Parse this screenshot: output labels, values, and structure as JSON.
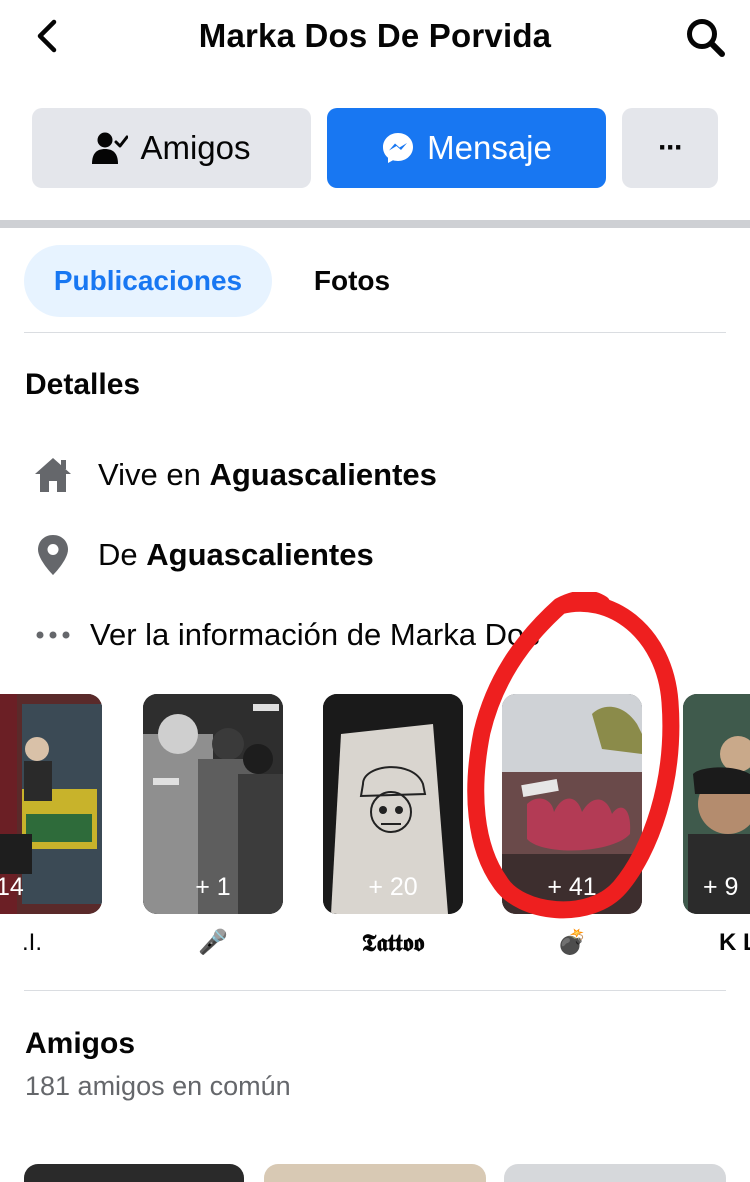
{
  "header": {
    "title": "Marka Dos De Porvida",
    "back_icon": "chevron-left-icon",
    "search_icon": "search-icon"
  },
  "actions": {
    "friends_label": "Amigos",
    "message_label": "Mensaje",
    "more_label": "···",
    "accent_color": "#1877f2"
  },
  "tabs": [
    {
      "label": "Publicaciones",
      "active": true
    },
    {
      "label": "Fotos",
      "active": false
    }
  ],
  "details": {
    "title": "Detalles",
    "lives_prefix": "Vive en ",
    "lives_city": "Aguascalientes",
    "from_prefix": "De ",
    "from_city": "Aguascalientes",
    "more_info": "Ver la información de Marka Dos"
  },
  "highlights": [
    {
      "count": "14",
      "label": ".I."
    },
    {
      "count": "+ 1",
      "label": "🎤"
    },
    {
      "count": "+ 20",
      "label": "𝕿𝖆𝖙𝖙𝖔𝖔"
    },
    {
      "count": "+ 41",
      "label": "💣"
    },
    {
      "count": "+ 9",
      "label": "K L"
    }
  ],
  "friends": {
    "title": "Amigos",
    "mutual": "181 amigos en común"
  }
}
